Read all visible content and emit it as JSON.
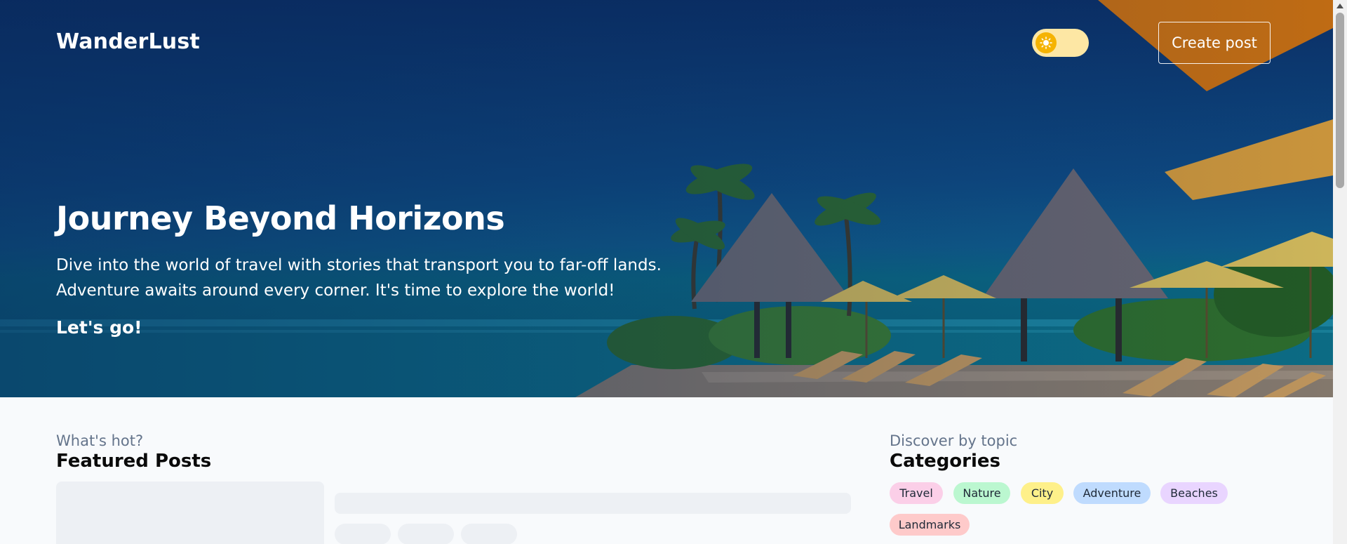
{
  "header": {
    "logo": "WanderLust",
    "theme_toggle": {
      "state": "light",
      "icon": "sun-icon",
      "accent": "#f5b301",
      "track": "#fde7a4"
    },
    "create_post_label": "Create post"
  },
  "hero": {
    "title": "Journey Beyond Horizons",
    "description": "Dive into the world of travel with stories that transport you to far-off lands. Adventure awaits around every corner. It's time to explore the world!",
    "cta": "Let's go!"
  },
  "featured": {
    "eyebrow": "What's hot?",
    "title": "Featured Posts",
    "state": "loading"
  },
  "categories": {
    "eyebrow": "Discover by topic",
    "title": "Categories",
    "items": [
      {
        "label": "Travel",
        "color": "#fbcfe8"
      },
      {
        "label": "Nature",
        "color": "#bbf7d0"
      },
      {
        "label": "City",
        "color": "#fef08a"
      },
      {
        "label": "Adventure",
        "color": "#bfdbfe"
      },
      {
        "label": "Beaches",
        "color": "#e9d5ff"
      },
      {
        "label": "Landmarks",
        "color": "#fecaca"
      }
    ]
  }
}
